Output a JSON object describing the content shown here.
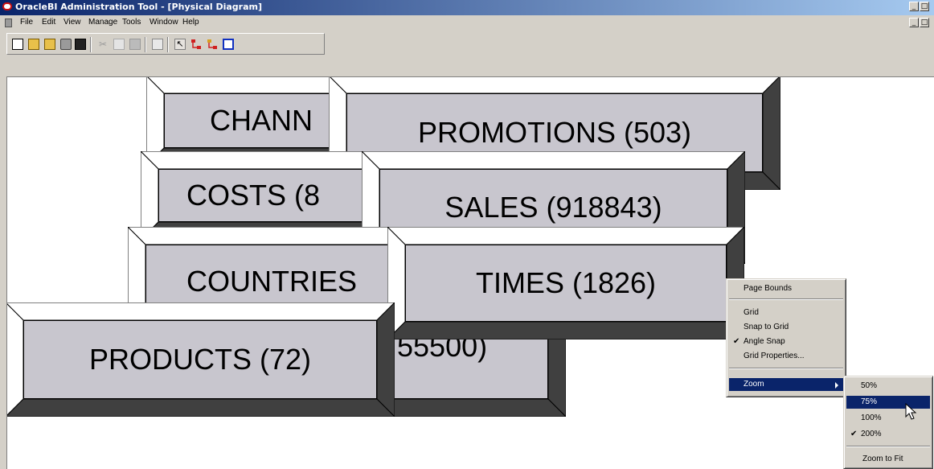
{
  "window": {
    "title": "OracleBI Administration Tool - [Physical Diagram]",
    "controls": [
      "_",
      "□",
      "_",
      "□"
    ]
  },
  "menubar": {
    "items": [
      "File",
      "Edit",
      "View",
      "Manage",
      "Tools",
      "Window",
      "Help"
    ]
  },
  "toolbar": {
    "icons": [
      "new-icon",
      "open-icon",
      "open-folder-icon",
      "import-icon",
      "save-icon",
      "cut-icon",
      "copy-icon",
      "paste-icon",
      "properties-icon",
      "select-pointer-icon",
      "new-join-icon",
      "new-complex-join-icon",
      "window-icon"
    ]
  },
  "diagram": {
    "tables": [
      {
        "label": "CHANN",
        "hidden_label": ""
      },
      {
        "label": "PROMOTIONS (503)"
      },
      {
        "label": "COSTS (8"
      },
      {
        "label": "SALES (918843)"
      },
      {
        "label": "COUNTRIES"
      },
      {
        "label": "TIMES (1826)"
      },
      {
        "label": "55500)"
      },
      {
        "label": "PRODUCTS (72)"
      }
    ]
  },
  "context_menu": {
    "items": [
      "Page Bounds",
      "Grid",
      "Snap to Grid",
      "Angle Snap",
      "Grid Properties...",
      "Zoom"
    ],
    "checked": "Angle Snap",
    "active": "Zoom"
  },
  "zoom_submenu": {
    "items": [
      "50%",
      "75%",
      "100%",
      "200%",
      "Zoom to Fit"
    ],
    "highlighted": "75%",
    "checked": "200%"
  },
  "colors": {
    "titlebar_start": "#0a246a",
    "titlebar_end": "#a6caf0",
    "highlight": "#0a246a",
    "table_face": "#c8c6ce"
  }
}
